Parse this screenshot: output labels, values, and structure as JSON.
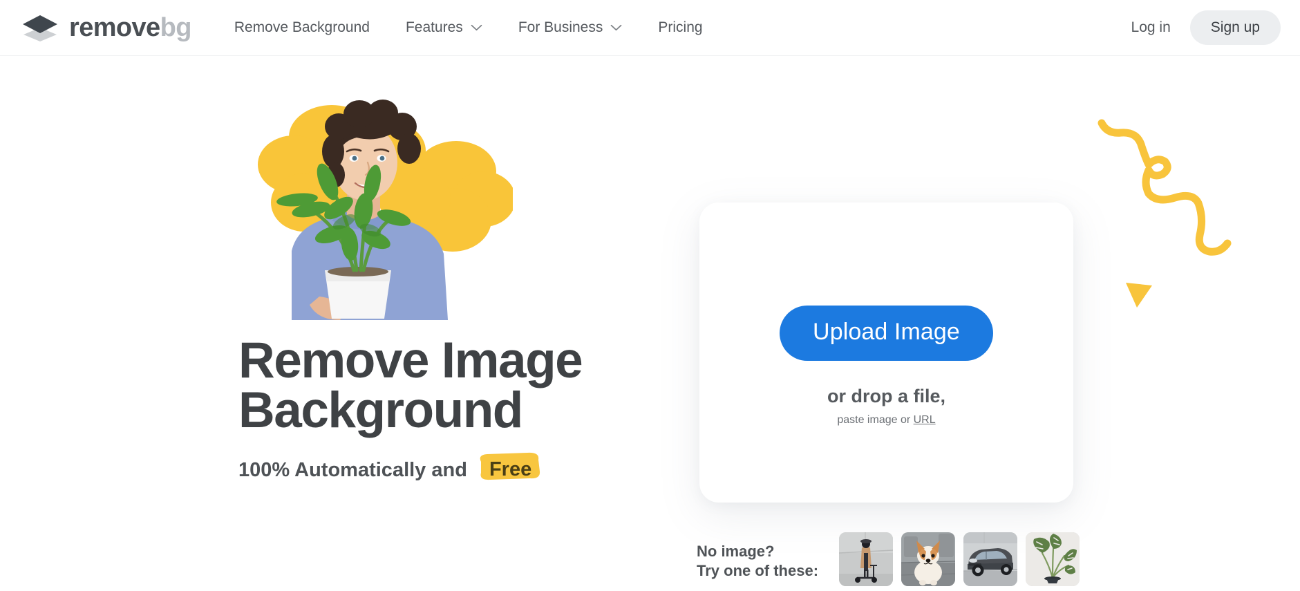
{
  "brand": {
    "logo_icon": "stacked-layers-icon",
    "name_dark": "remove",
    "name_light": "bg",
    "color_dark": "#4a4f54",
    "color_light": "#b6babf"
  },
  "header": {
    "nav": [
      {
        "label": "Remove Background",
        "has_dropdown": false
      },
      {
        "label": "Features",
        "has_dropdown": true,
        "icon": "chevron-down-icon"
      },
      {
        "label": "For Business",
        "has_dropdown": true,
        "icon": "chevron-down-icon"
      },
      {
        "label": "Pricing",
        "has_dropdown": false
      }
    ],
    "login_label": "Log in",
    "signup_label": "Sign up"
  },
  "hero": {
    "headline_line1": "Remove Image",
    "headline_line2": "Background",
    "subline_text": "100% Automatically and",
    "free_label": "Free",
    "photo_alt": "man-holding-potted-plant-photo",
    "accent_yellow": "#f9c23c",
    "headline_color": "#3f4245"
  },
  "upload": {
    "button_label": "Upload Image",
    "button_color": "#1c7ae0",
    "drop_text": "or drop a file,",
    "paste_prefix": "paste image or ",
    "url_label": "URL"
  },
  "samples": {
    "label_line1": "No image?",
    "label_line2": "Try one of these:",
    "thumbnails": [
      {
        "name": "woman-on-scooter-thumbnail"
      },
      {
        "name": "corgi-dog-thumbnail"
      },
      {
        "name": "gray-car-thumbnail"
      },
      {
        "name": "monstera-plant-thumbnail"
      }
    ]
  },
  "decor": {
    "squiggle": "yellow-squiggle-line",
    "triangle": "yellow-triangle"
  }
}
